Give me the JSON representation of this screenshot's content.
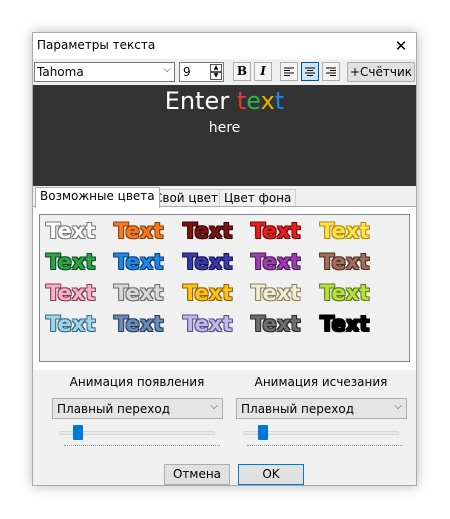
{
  "window": {
    "title": "Параметры текста"
  },
  "toolbar": {
    "font": "Tahoma",
    "size": "9",
    "bold_label": "B",
    "italic_label": "I",
    "counter_label": "+Счётчик"
  },
  "preview": {
    "line1_word1": "Enter",
    "line1_letters": [
      "t",
      "e",
      "x",
      "t"
    ],
    "line1_letter_colors": [
      "#e43a3a",
      "#2fb24a",
      "#f0b000",
      "#1e88e5"
    ],
    "line2": "here",
    "background": "#333333"
  },
  "tabs": [
    "Возможные цвета",
    "Свой цвет",
    "Цвет фона"
  ],
  "samples": {
    "label": "Text",
    "rows": [
      [
        {
          "fill": "#ffffff",
          "stroke": "#7a7a7a"
        },
        {
          "fill": "#f47c20",
          "stroke": "#8a3b00"
        },
        {
          "fill": "#7a1414",
          "stroke": "#3a0000"
        },
        {
          "fill": "#e42020",
          "stroke": "#7a0000"
        },
        {
          "fill": "#ffe14a",
          "stroke": "#b08a00"
        }
      ],
      [
        {
          "fill": "#2fa34a",
          "stroke": "#0d4d1d"
        },
        {
          "fill": "#1e88e5",
          "stroke": "#0b3f7a"
        },
        {
          "fill": "#3a3aa8",
          "stroke": "#151555"
        },
        {
          "fill": "#9b3fb0",
          "stroke": "#4d1a5a"
        },
        {
          "fill": "#a0705a",
          "stroke": "#4d2e20"
        }
      ],
      [
        {
          "fill": "#f5b3c8",
          "stroke": "#8a3a55"
        },
        {
          "fill": "#d8d8d8",
          "stroke": "#6a6a6a"
        },
        {
          "fill": "#ffc21a",
          "stroke": "#8a6200"
        },
        {
          "fill": "#f2ecd2",
          "stroke": "#8a8060"
        },
        {
          "fill": "#b8e040",
          "stroke": "#5a7a10"
        }
      ],
      [
        {
          "fill": "#9fd3ea",
          "stroke": "#3a6a80"
        },
        {
          "fill": "#6a8ab8",
          "stroke": "#2a3d5a"
        },
        {
          "fill": "#c2b8e6",
          "stroke": "#5a4d8a"
        },
        {
          "fill": "#6e6e6e",
          "stroke": "#2a2a2a"
        },
        {
          "fill": "#000000",
          "stroke": "#000000"
        }
      ]
    ]
  },
  "animation": {
    "appear_label": "Анимация появления",
    "appear_value": "Плавный переход",
    "appear_level": 0.1,
    "disappear_label": "Анимация исчезания",
    "disappear_value": "Плавный переход",
    "disappear_level": 0.1
  },
  "buttons": {
    "cancel": "Отмена",
    "ok": "OK"
  }
}
